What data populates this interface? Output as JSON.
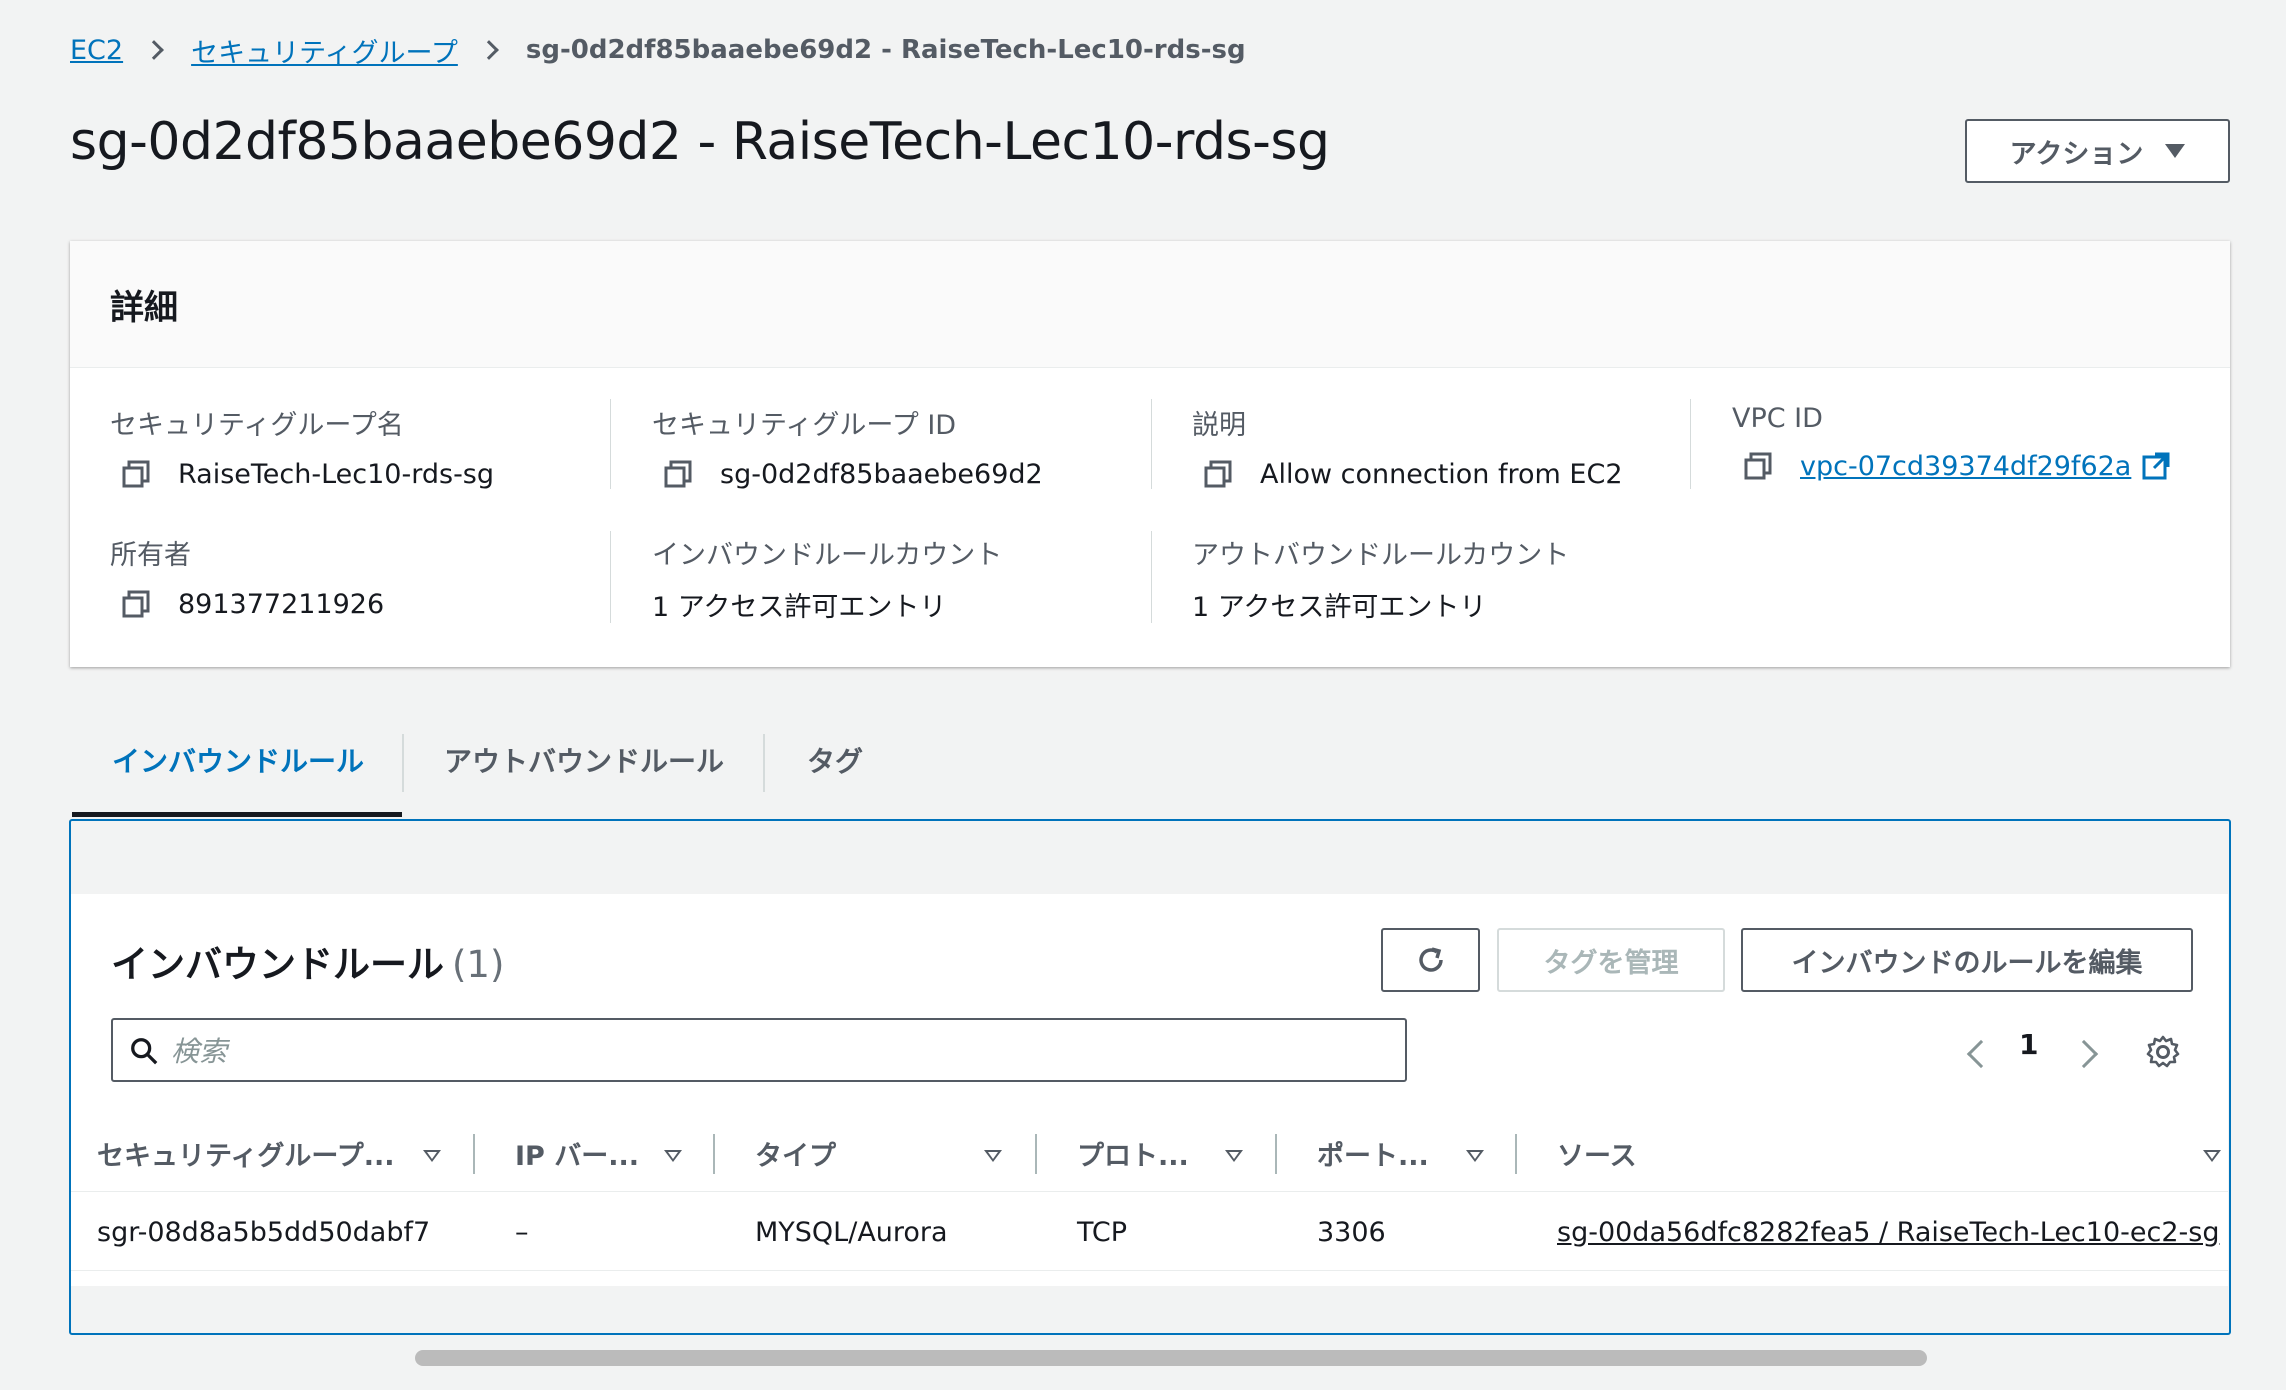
{
  "breadcrumb": {
    "items": [
      "EC2",
      "セキュリティグループ"
    ],
    "current": "sg-0d2df85baaebe69d2 - RaiseTech-Lec10-rds-sg"
  },
  "page_title": "sg-0d2df85baaebe69d2 - RaiseTech-Lec10-rds-sg",
  "actions_button": "アクション",
  "details": {
    "heading": "詳細",
    "sg_name_label": "セキュリティグループ名",
    "sg_name_value": "RaiseTech-Lec10-rds-sg",
    "sg_id_label": "セキュリティグループ ID",
    "sg_id_value": "sg-0d2df85baaebe69d2",
    "description_label": "説明",
    "description_value": "Allow connection from EC2",
    "vpc_label": "VPC ID",
    "vpc_value": "vpc-07cd39374df29f62a",
    "owner_label": "所有者",
    "owner_value": "891377211926",
    "inbound_count_label": "インバウンドルールカウント",
    "inbound_count_value": "1 アクセス許可エントリ",
    "outbound_count_label": "アウトバウンドルールカウント",
    "outbound_count_value": "1 アクセス許可エントリ"
  },
  "tabs": [
    {
      "label": "インバウンドルール",
      "active": true
    },
    {
      "label": "アウトバウンドルール",
      "active": false
    },
    {
      "label": "タグ",
      "active": false
    }
  ],
  "rules": {
    "title": "インバウンドルール",
    "count": "(1)",
    "manage_tags_button": "タグを管理",
    "edit_rules_button": "インバウンドのルールを編集",
    "search_placeholder": "検索",
    "page_number": "1",
    "columns": [
      "セキュリティグループ...",
      "IP バー...",
      "タイプ",
      "プロト...",
      "ポート...",
      "ソース"
    ],
    "rows": [
      {
        "rule_id": "sgr-08d8a5b5dd50dabf7",
        "ip_version": "–",
        "type": "MYSQL/Aurora",
        "protocol": "TCP",
        "port": "3306",
        "source": "sg-00da56dfc8282fea5 / RaiseTech-Lec10-ec2-sg"
      }
    ]
  },
  "colors": {
    "link": "#0073bb",
    "text": "#16191f",
    "secondary_text": "#545b64",
    "background": "#f2f3f3"
  }
}
